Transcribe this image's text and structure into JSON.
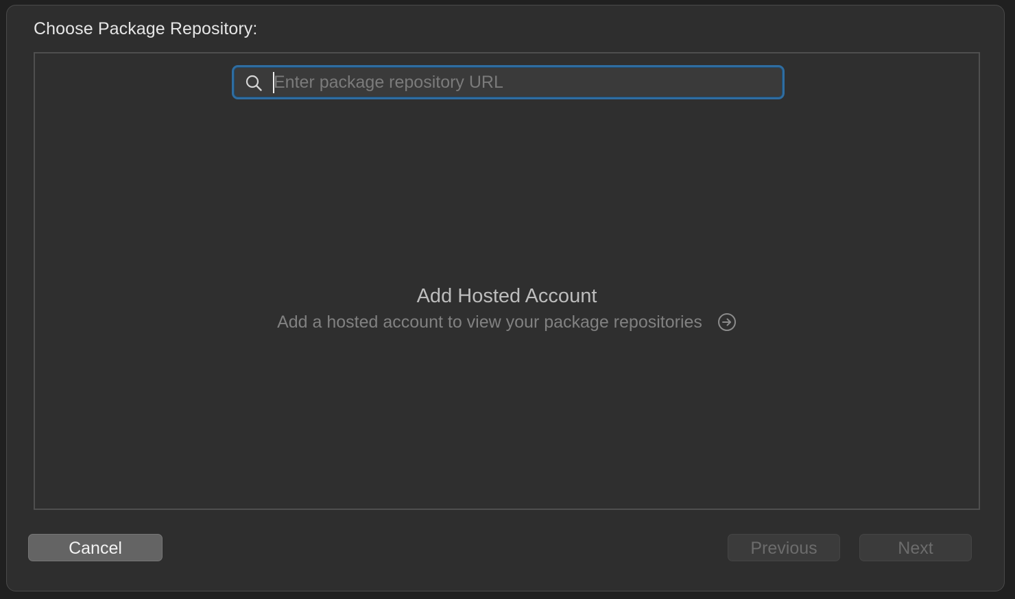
{
  "dialog": {
    "title": "Choose Package Repository:"
  },
  "search": {
    "placeholder": "Enter package repository URL",
    "value": "",
    "icon": "search-icon"
  },
  "empty_state": {
    "title": "Add Hosted Account",
    "subtitle": "Add a hosted account to view your package repositories",
    "action_icon": "arrow-right-circle-icon"
  },
  "buttons": {
    "cancel": "Cancel",
    "previous": "Previous",
    "next": "Next"
  },
  "colors": {
    "sheet_background": "#2e2e2e",
    "focus_ring": "#2f6da1",
    "primary_text": "#e6e6e6",
    "secondary_text": "#818181"
  }
}
